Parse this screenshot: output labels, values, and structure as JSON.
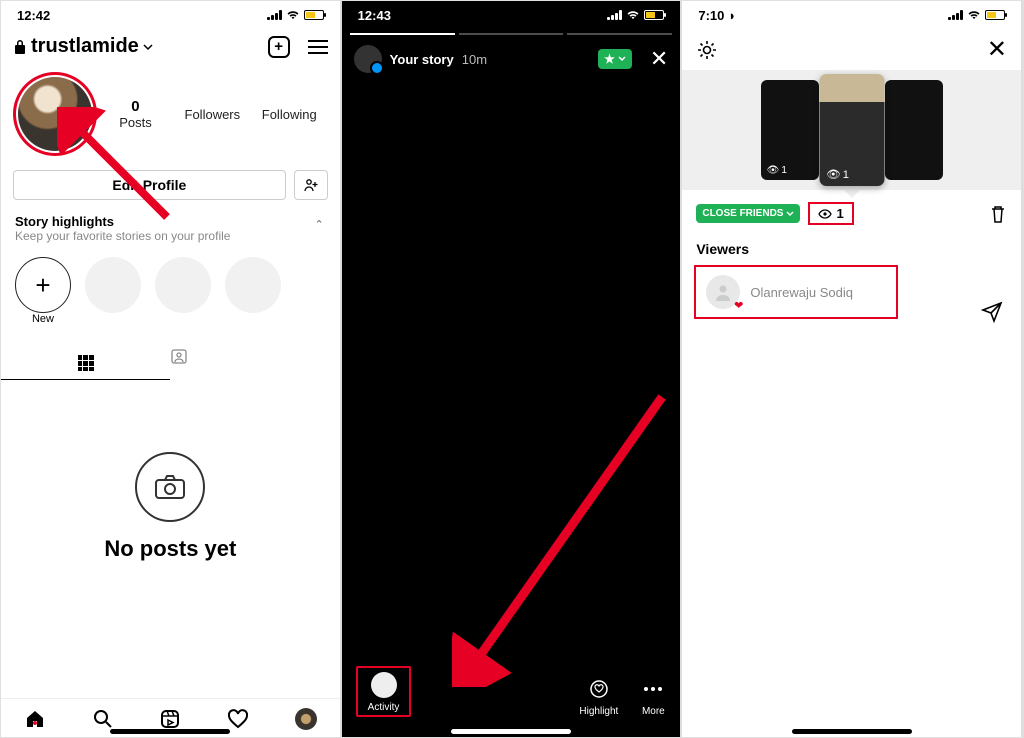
{
  "screen1": {
    "status_time": "12:42",
    "username": "trustlamide",
    "stats": {
      "posts_count": "0",
      "posts_label": "Posts",
      "followers_label": "Followers",
      "following_label": "Following"
    },
    "edit_profile": "Edit Profile",
    "highlights_title": "Story highlights",
    "highlights_sub": "Keep your favorite stories on your profile",
    "new_label": "New",
    "empty_msg": "No posts yet"
  },
  "screen2": {
    "status_time": "12:43",
    "story_label": "Your story",
    "story_age": "10m",
    "activity": "Activity",
    "highlight": "Highlight",
    "more": "More"
  },
  "screen3": {
    "status_time": "7:10",
    "close_friends": "CLOSE FRIENDS",
    "view_count": "1",
    "viewers_header": "Viewers",
    "viewer_name": "Olanrewaju Sodiq",
    "thumb_view": "1"
  }
}
